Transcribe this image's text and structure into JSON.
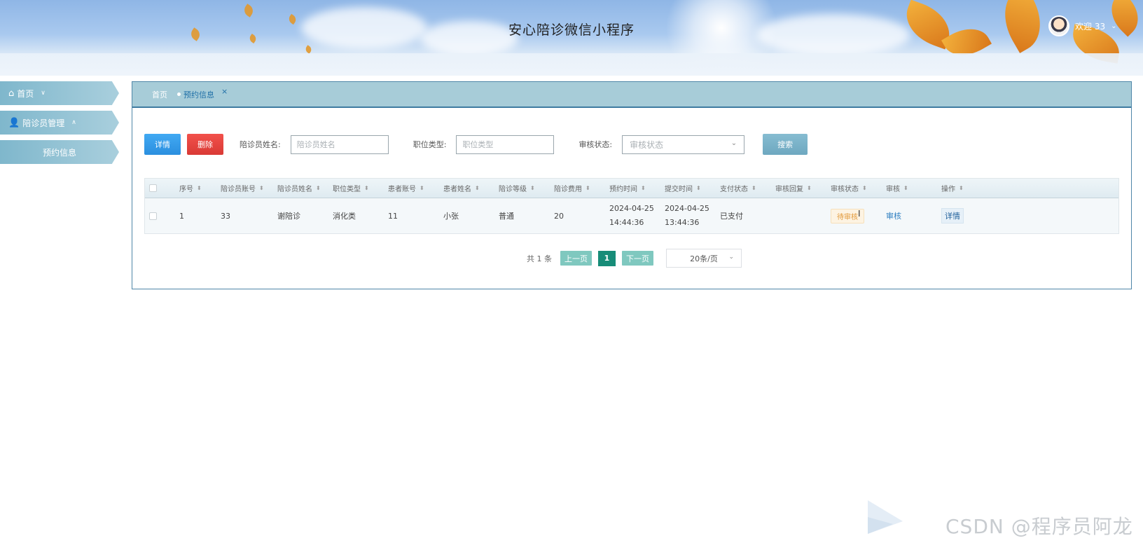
{
  "header": {
    "title": "安心陪诊微信小程序",
    "user_label": "欢迎 33"
  },
  "sidebar": {
    "items": [
      {
        "label": "首页",
        "icon": "home-icon"
      },
      {
        "label": "陪诊员管理",
        "icon": "user-icon"
      },
      {
        "label": "预约信息"
      }
    ]
  },
  "tabs": {
    "home": "首页",
    "active": "预约信息",
    "close": "×"
  },
  "toolbar": {
    "detail_label": "详情",
    "delete_label": "删除",
    "search_label": "搜索",
    "fields": {
      "companion_name_label": "陪诊员姓名:",
      "companion_name_placeholder": "陪诊员姓名",
      "position_label": "职位类型:",
      "position_placeholder": "职位类型",
      "review_label": "审核状态:",
      "review_placeholder": "审核状态"
    }
  },
  "table": {
    "headers": [
      "序号",
      "陪诊员账号",
      "陪诊员姓名",
      "职位类型",
      "患者账号",
      "患者姓名",
      "陪诊等级",
      "陪诊费用",
      "预约时间",
      "提交时间",
      "支付状态",
      "审核回复",
      "审核状态",
      "审核",
      "操作"
    ],
    "rows": [
      {
        "index": "1",
        "companion_account": "33",
        "companion_name": "谢陪诊",
        "position": "消化类",
        "patient_account": "11",
        "patient_name": "小张",
        "level": "普通",
        "fee": "20",
        "appointment_date": "2024-04-25",
        "appointment_time": "14:44:36",
        "submit_date": "2024-04-25",
        "submit_time": "13:44:36",
        "payment_status": "已支付",
        "review_reply": "",
        "review_status": "待审核",
        "review_action": "审核",
        "operation": "详情"
      }
    ]
  },
  "pagination": {
    "total": "共 1 条",
    "prev": "上一页",
    "current": "1",
    "next": "下一页",
    "page_size": "20条/页"
  },
  "watermark": "CSDN @程序员阿龙",
  "colors": {
    "accent": "#2b8fdf",
    "danger": "#d93a35",
    "sidebar": "#7fb7cc",
    "pager_active": "#178c78"
  }
}
